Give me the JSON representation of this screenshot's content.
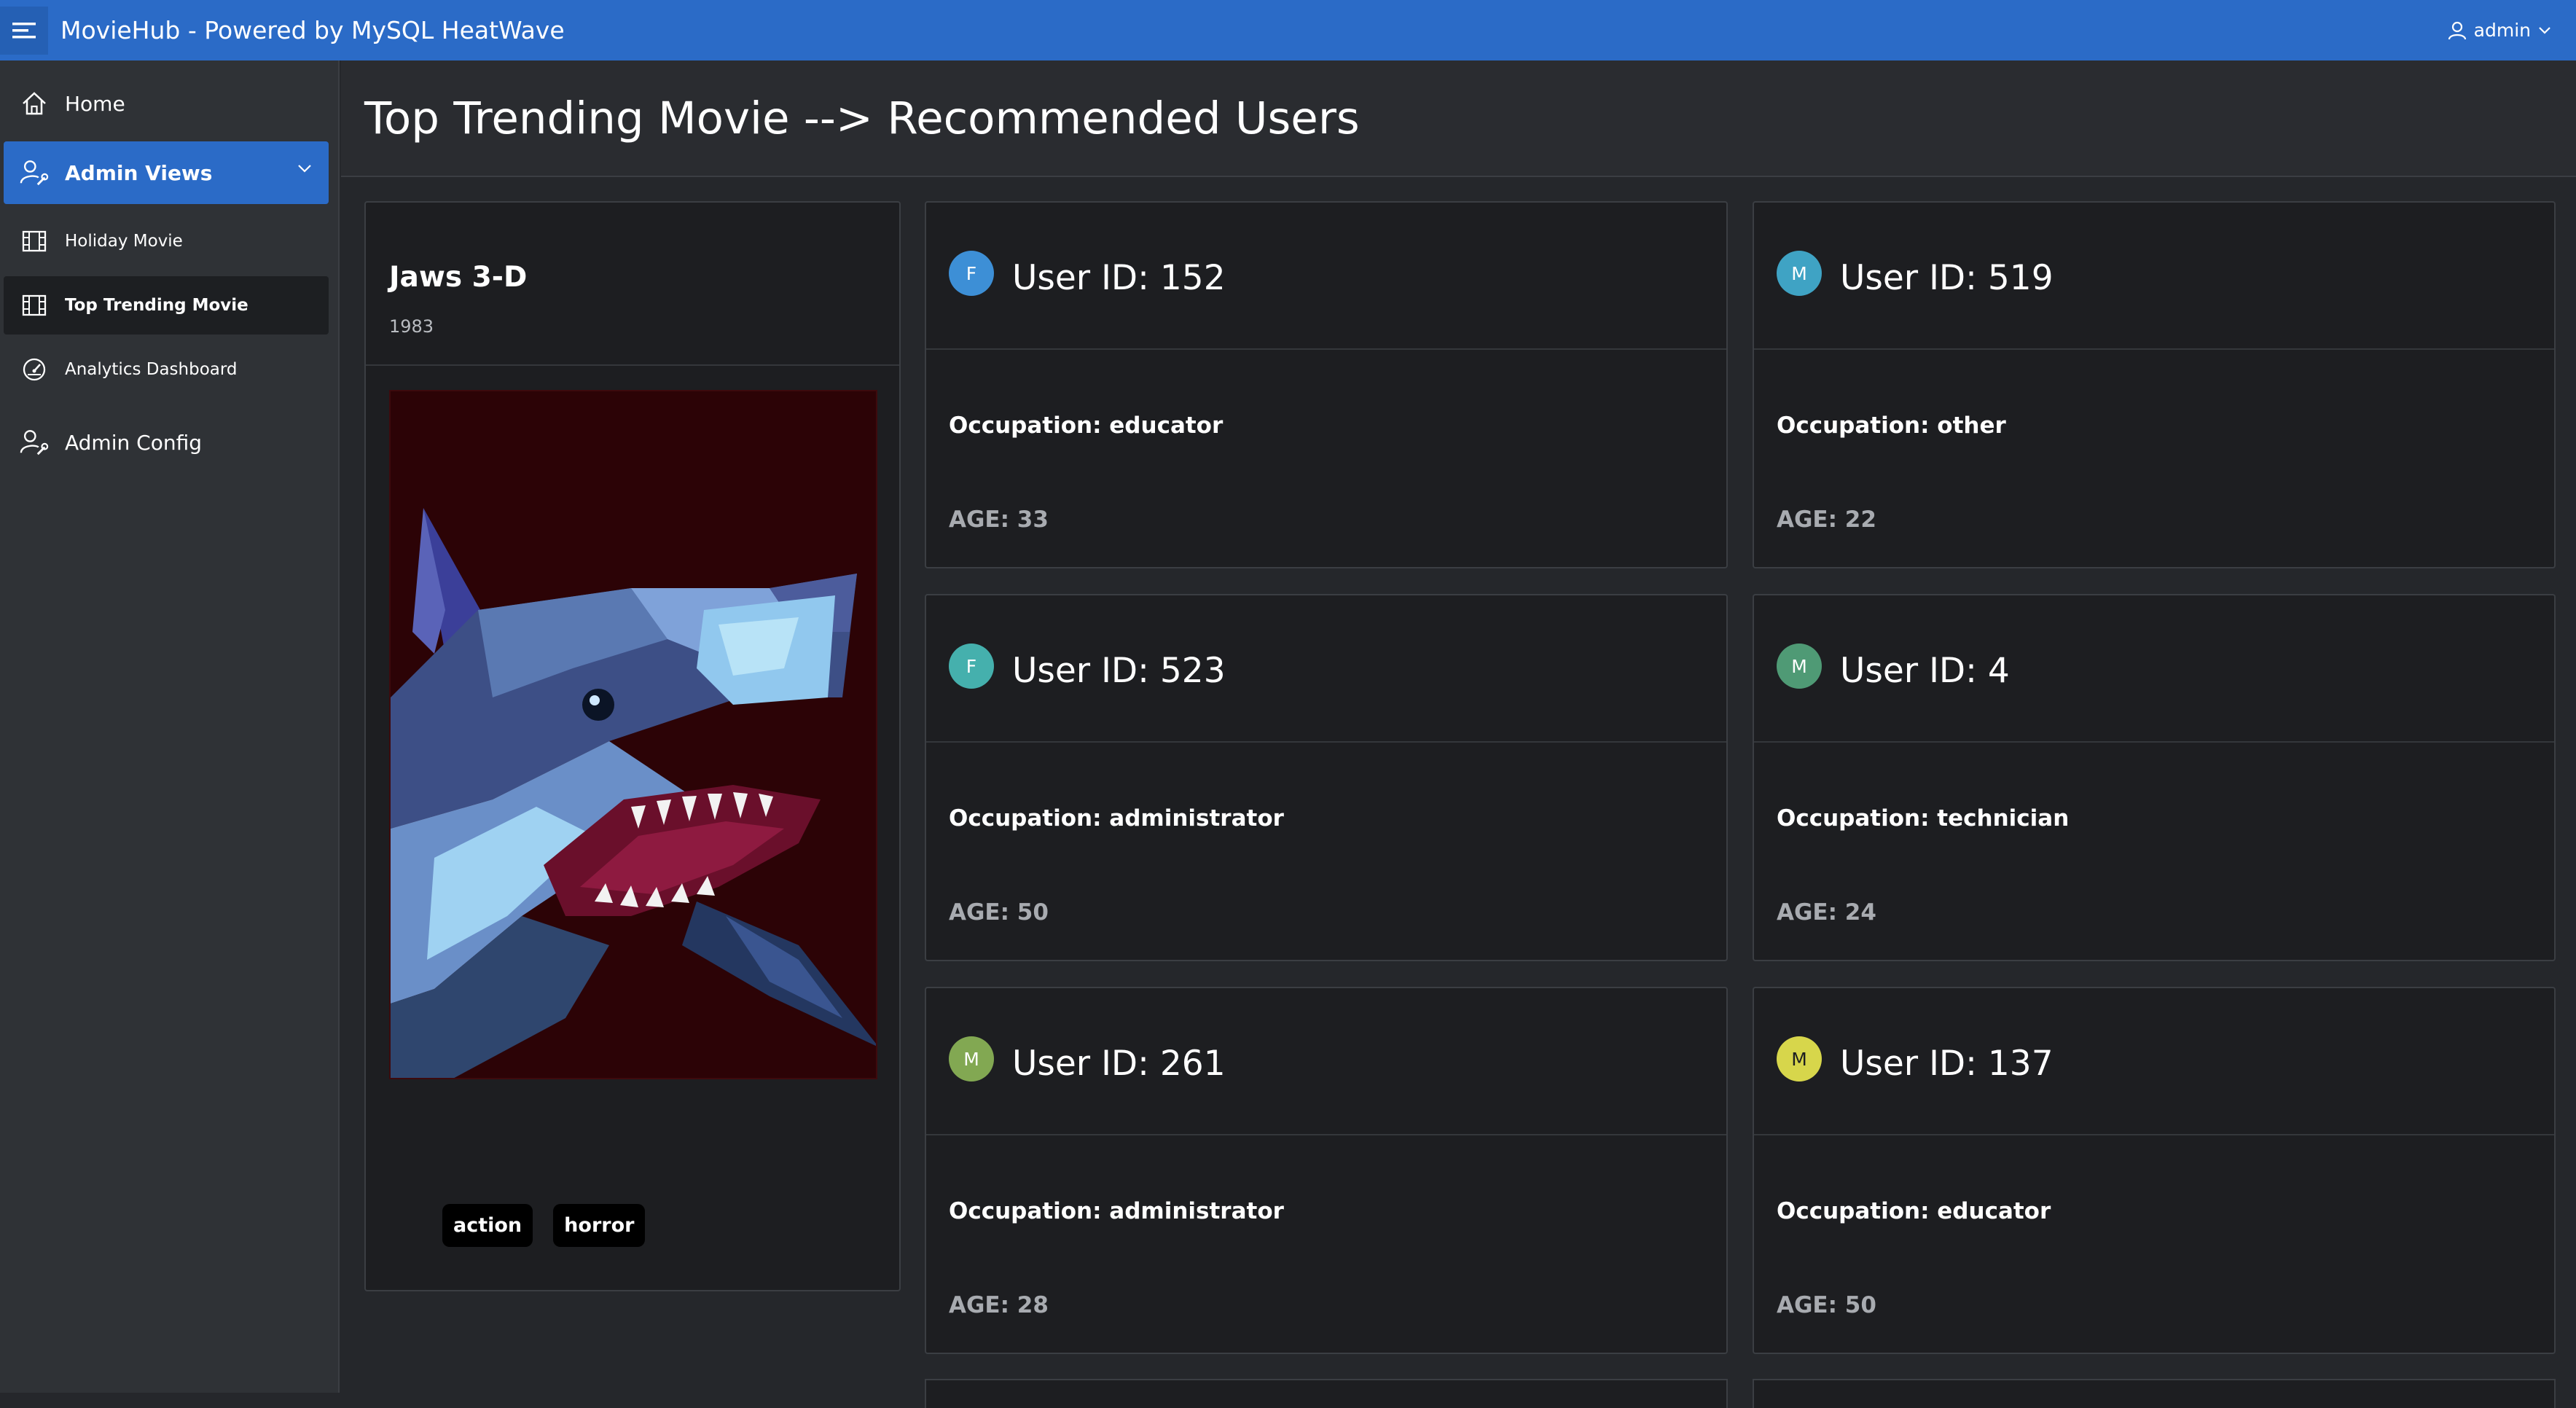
{
  "app": {
    "title": "MovieHub - Powered by MySQL HeatWave",
    "user": "admin"
  },
  "colors": {
    "topbar": "#2b6bc7",
    "sidebar": "#2f3236",
    "card": "#1d1e21",
    "background": "#25272b"
  },
  "sidebar": {
    "items": [
      {
        "label": "Home",
        "icon": "home-icon"
      },
      {
        "label": "Admin Views",
        "icon": "user-wrench-icon",
        "expanded": true
      },
      {
        "label": "Holiday Movie",
        "icon": "film-icon"
      },
      {
        "label": "Top Trending Movie",
        "icon": "film-icon",
        "current": true
      },
      {
        "label": "Analytics Dashboard",
        "icon": "gauge-icon"
      },
      {
        "label": "Admin Config",
        "icon": "user-wrench-icon"
      }
    ]
  },
  "page": {
    "title": "Top Trending Movie --> Recommended Users"
  },
  "movie": {
    "title": "Jaws 3-D",
    "year": "1983",
    "genres": [
      "action",
      "horror"
    ]
  },
  "users": [
    {
      "initial": "F",
      "title": "User ID: 152",
      "occupation": "Occupation: educator",
      "age": "AGE: 33",
      "color": "#3d8fd6"
    },
    {
      "initial": "M",
      "title": "User ID: 519",
      "occupation": "Occupation: other",
      "age": "AGE: 22",
      "color": "#3fa3c4"
    },
    {
      "initial": "F",
      "title": "User ID: 523",
      "occupation": "Occupation: administrator",
      "age": "AGE: 50",
      "color": "#45b0ad"
    },
    {
      "initial": "M",
      "title": "User ID: 4",
      "occupation": "Occupation: technician",
      "age": "AGE: 24",
      "color": "#4f9a75"
    },
    {
      "initial": "M",
      "title": "User ID: 261",
      "occupation": "Occupation: administrator",
      "age": "AGE: 28",
      "color": "#82a852"
    },
    {
      "initial": "M",
      "title": "User ID: 137",
      "occupation": "Occupation: educator",
      "age": "AGE: 50",
      "color": "#d7d64b"
    }
  ]
}
